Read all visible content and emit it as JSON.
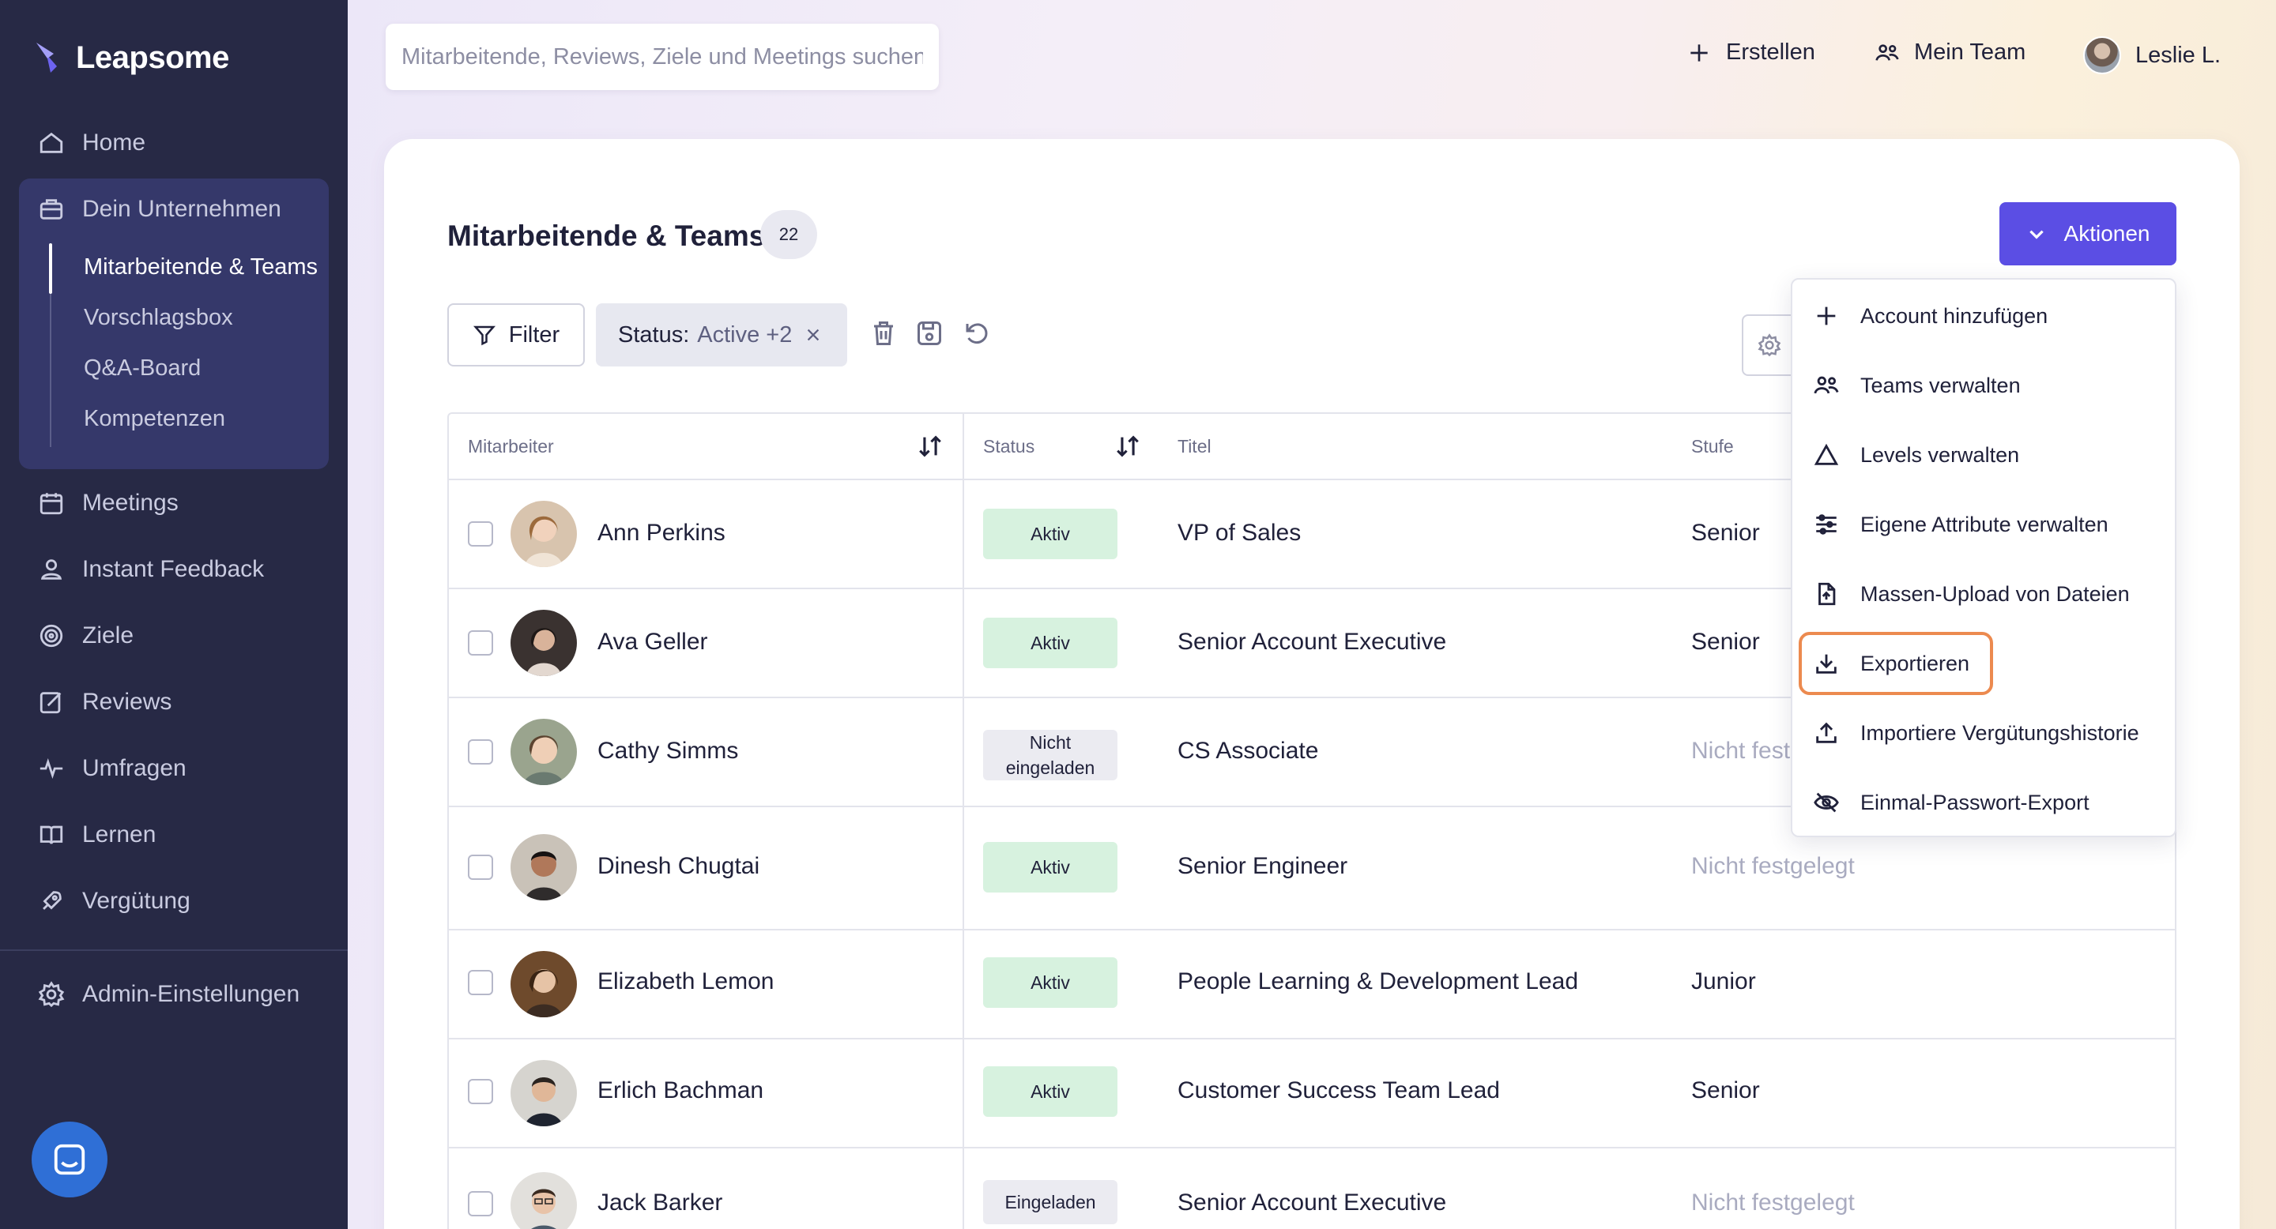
{
  "brand": {
    "name": "Leapsome"
  },
  "sidebar": {
    "items": [
      {
        "label": "Home",
        "icon": "home-icon"
      },
      {
        "label": "Dein Unternehmen",
        "icon": "building-icon"
      },
      {
        "label": "Meetings",
        "icon": "calendar-icon"
      },
      {
        "label": "Instant Feedback",
        "icon": "feedback-icon"
      },
      {
        "label": "Ziele",
        "icon": "target-icon"
      },
      {
        "label": "Reviews",
        "icon": "edit-icon"
      },
      {
        "label": "Umfragen",
        "icon": "pulse-icon"
      },
      {
        "label": "Lernen",
        "icon": "book-icon"
      },
      {
        "label": "Vergütung",
        "icon": "rocket-icon"
      },
      {
        "label": "Admin-Einstellungen",
        "icon": "gear-icon"
      }
    ],
    "sub_items": [
      {
        "label": "Mitarbeitende & Teams",
        "active": true
      },
      {
        "label": "Vorschlagsbox"
      },
      {
        "label": "Q&A-Board"
      },
      {
        "label": "Kompetenzen"
      }
    ]
  },
  "header": {
    "search_placeholder": "Mitarbeitende, Reviews, Ziele und Meetings suchen",
    "create_label": "Erstellen",
    "team_label": "Mein Team",
    "user_name": "Leslie L."
  },
  "main": {
    "title": "Mitarbeitende & Teams",
    "count": "22",
    "actions_label": "Aktionen",
    "filter_label": "Filter",
    "chip_key": "Status:",
    "chip_value": "Active +2"
  },
  "table": {
    "headers": {
      "employee": "Mitarbeiter",
      "status": "Status",
      "title": "Titel",
      "level": "Stufe"
    },
    "rows": [
      {
        "name": "Ann Perkins",
        "status": "Aktiv",
        "title": "VP of Sales",
        "level": "Senior"
      },
      {
        "name": "Ava Geller",
        "status": "Aktiv",
        "title": "Senior Account Executive",
        "level": "Senior"
      },
      {
        "name": "Cathy Simms",
        "status": "Nicht eingeladen",
        "title": "CS Associate",
        "level": "Nicht festgelegt"
      },
      {
        "name": "Dinesh Chugtai",
        "status": "Aktiv",
        "title": "Senior Engineer",
        "level": "Nicht festgelegt"
      },
      {
        "name": "Elizabeth Lemon",
        "status": "Aktiv",
        "title": "People Learning & Development Lead",
        "level": "Junior"
      },
      {
        "name": "Erlich Bachman",
        "status": "Aktiv",
        "title": "Customer Success Team Lead",
        "level": "Senior"
      },
      {
        "name": "Jack Barker",
        "status": "Eingeladen",
        "title": "Senior Account Executive",
        "level": "Nicht festgelegt"
      }
    ]
  },
  "dropdown": {
    "items": [
      {
        "label": "Account hinzufügen",
        "icon": "plus-icon"
      },
      {
        "label": "Teams verwalten",
        "icon": "team-icon"
      },
      {
        "label": "Levels verwalten",
        "icon": "triangle-icon"
      },
      {
        "label": "Eigene Attribute verwalten",
        "icon": "sliders-icon"
      },
      {
        "label": "Massen-Upload von Dateien",
        "icon": "file-upload-icon"
      },
      {
        "label": "Exportieren",
        "icon": "download-icon",
        "highlighted": true
      },
      {
        "label": "Importiere Vergütungshistorie",
        "icon": "upload-icon"
      },
      {
        "label": "Einmal-Passwort-Export",
        "icon": "eye-off-icon"
      }
    ]
  },
  "colors": {
    "accent": "#5b4ee4",
    "sidebar": "#272945",
    "highlight": "#ec8a4f",
    "active_status": "#d7f2df"
  }
}
